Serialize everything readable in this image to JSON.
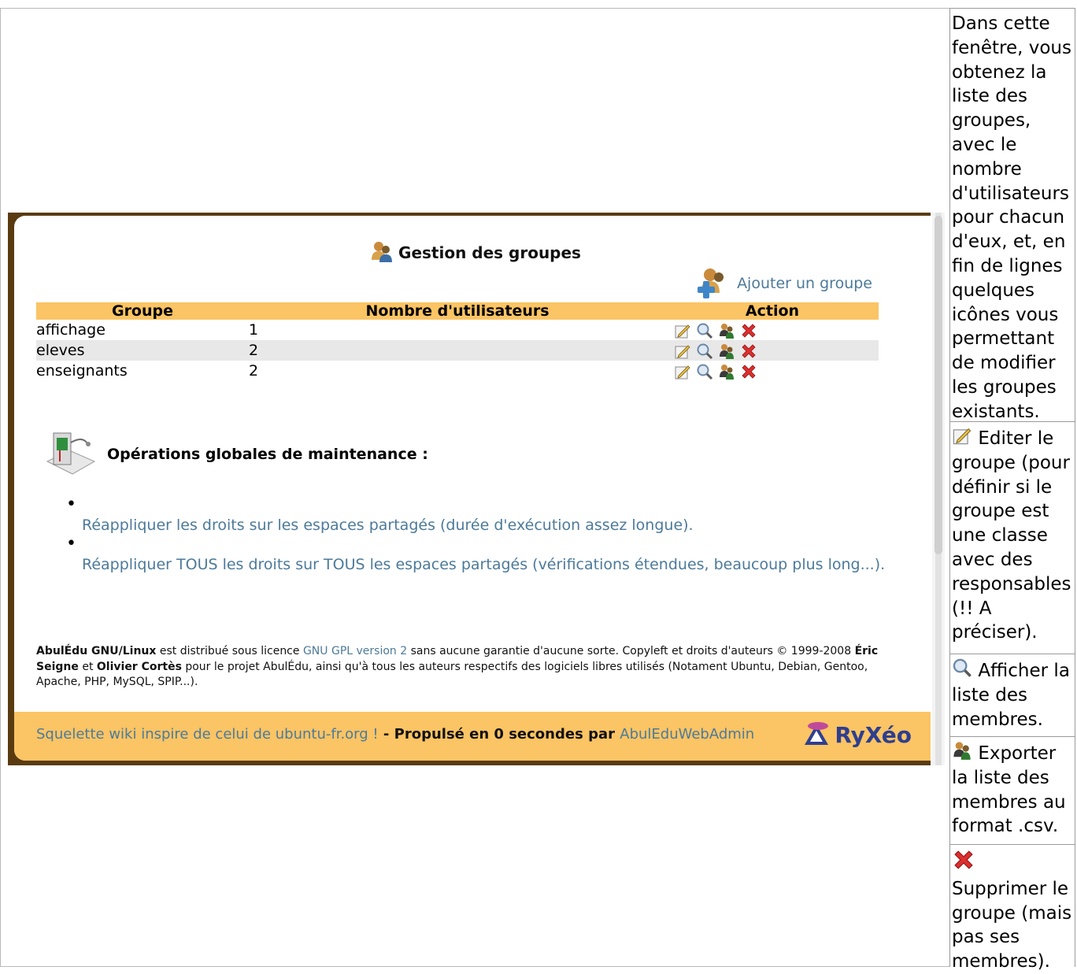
{
  "description_cells": [
    "Dans cette fenêtre, vous obtenez la liste des groupes, avec le nombre d'utilisateurs pour chacun d'eux, et, en fin de lignes quelques icônes vous permettant de modifier les groupes existants.",
    "Editer le groupe (pour définir si le groupe est une classe avec des responsables (!! A préciser).",
    "Afficher la liste des membres.",
    "Exporter la liste des membres au format .csv.",
    "Supprimer le groupe (mais pas ses membres)."
  ],
  "app": {
    "title": "Gestion des groupes",
    "add_group_label": "Ajouter un groupe",
    "table": {
      "headers": [
        "Groupe",
        "Nombre d'utilisateurs",
        "Action"
      ],
      "rows": [
        {
          "groupe": "affichage",
          "nombre": "1"
        },
        {
          "groupe": "eleves",
          "nombre": "2"
        },
        {
          "groupe": "enseignants",
          "nombre": "2"
        }
      ]
    },
    "maintenance": {
      "title": "Opérations globales de maintenance :",
      "links": [
        "Réappliquer les droits sur les espaces partagés (durée d'exécution assez longue).",
        "Réappliquer TOUS les droits sur TOUS les espaces partagés (vérifications étendues, beaucoup plus long...)."
      ]
    },
    "legal": {
      "product": "AbulÉdu GNU/Linux",
      "text1": " est distribué sous licence ",
      "license_link": "GNU GPL version 2",
      "text2": " sans aucune garantie d'aucune sorte. Copyleft et droits d'auteurs © 1999-2008 ",
      "author1": "Éric Seigne",
      "text3": " et ",
      "author2": "Olivier Cortès",
      "text4": " pour le projet AbulÉdu, ainsi qu'à tous les auteurs respectifs des logiciels libres utilisés (Notament Ubuntu, Debian, Gentoo, Apache, PHP, MySQL, SPIP...)."
    },
    "footer": {
      "link1": "Squelette wiki inspire de celui de ubuntu-fr.org !",
      "text": " - Propulsé en 0 secondes par ",
      "link2": "AbulEduWebAdmin",
      "logo": "RyXéo"
    }
  },
  "colors": {
    "header_bg": "#fbc464",
    "frame": "#5a3b10",
    "link": "#4c7a9a",
    "logo": "#2e3f90",
    "delete": "#d93030"
  },
  "icons": {
    "title": "group-icon",
    "add": "add-group-icon",
    "edit": "edit-icon",
    "view": "magnifier-icon",
    "export": "export-members-icon",
    "delete": "delete-cross-icon",
    "maintenance": "maintenance-icon",
    "logo": "ryxeo-logo-icon"
  }
}
